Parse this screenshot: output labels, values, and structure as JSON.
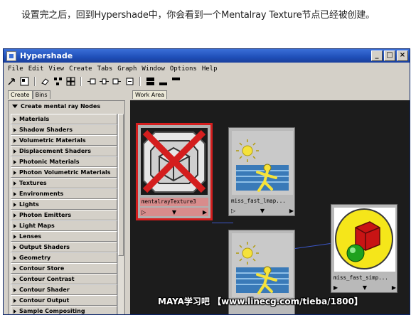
{
  "caption": "设置完之后，回到Hypershade中，你会看到一个Mentalray Texture节点已经被创建。",
  "window": {
    "title": "Hypershade",
    "buttons": [
      "_",
      "□",
      "×"
    ]
  },
  "menu": [
    "File",
    "Edit",
    "View",
    "Create",
    "Tabs",
    "Graph",
    "Window",
    "Options",
    "Help"
  ],
  "left_tabs": [
    "Create",
    "Bins"
  ],
  "panel_header": "Create mental ray Nodes",
  "categories": [
    "Materials",
    "Shadow Shaders",
    "Volumetric Materials",
    "Displacement Shaders",
    "Photonic Materials",
    "Photon Volumetric Materials",
    "Textures",
    "Environments",
    "Lights",
    "Photon Emitters",
    "Light Maps",
    "Lenses",
    "Output Shaders",
    "Geometry",
    "Contour Store",
    "Contour Contrast",
    "Contour Shader",
    "Contour Output",
    "Sample Compositing"
  ],
  "work_tab": "Work Area",
  "nodes": [
    {
      "label": "mentalrayTexture3"
    },
    {
      "label": "miss_fast_lmap..."
    },
    {
      "label": "miss_fast_simp..."
    },
    {
      "label": ""
    }
  ],
  "watermark": "MAYA学习吧  【www.linecg.com/tieba/1800】",
  "colors": {
    "titlebar": "#1f4fb8",
    "window_bg": "#d4d0c8",
    "work_area": "#1c1c1c",
    "selected_node_border": "#d41e1e",
    "selected_label_bg": "#d88c8c",
    "connection": "#3b56c8"
  }
}
